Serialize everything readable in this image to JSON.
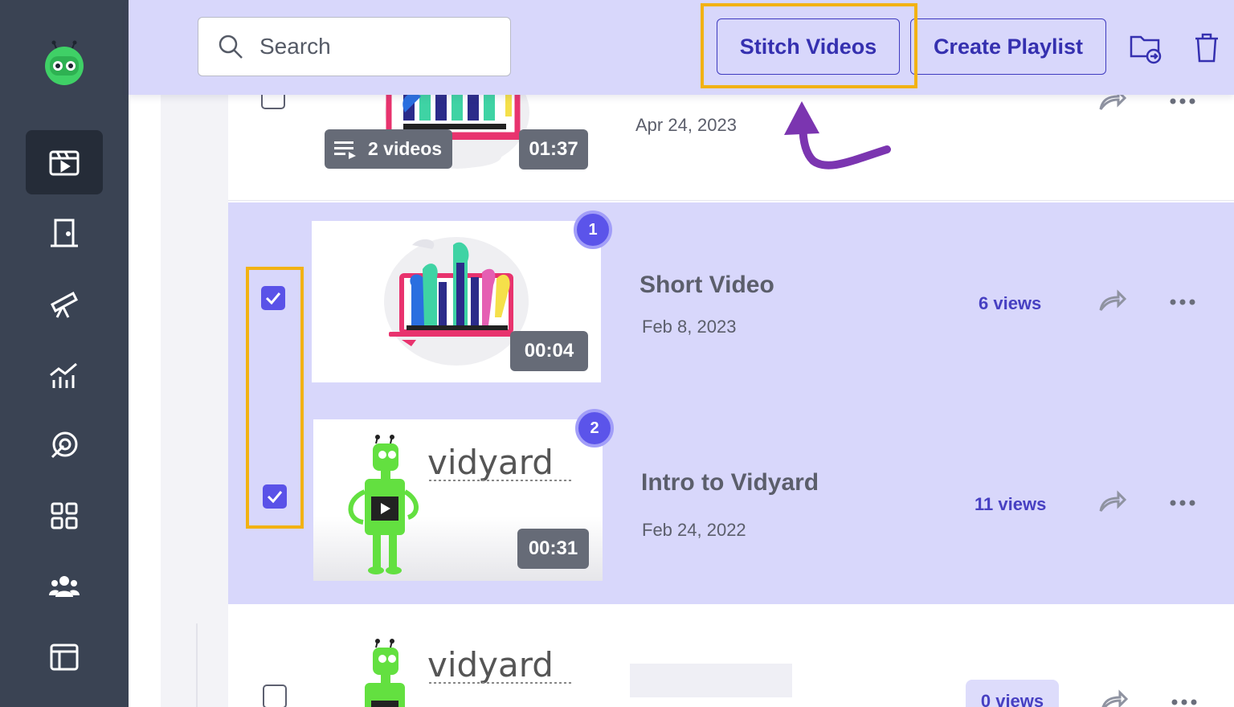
{
  "toolbar": {
    "search_placeholder": "Search",
    "stitch_label": "Stitch Videos",
    "playlist_label": "Create Playlist",
    "icons": [
      "move-to-folder-icon",
      "trash-icon"
    ]
  },
  "sidebar": {
    "items": [
      {
        "name": "videos",
        "icon": "video-library-icon",
        "active": true
      },
      {
        "name": "rooms",
        "icon": "door-icon",
        "active": false
      },
      {
        "name": "prospecting",
        "icon": "telescope-icon",
        "active": false
      },
      {
        "name": "analytics",
        "icon": "chart-icon",
        "active": false
      },
      {
        "name": "engagement",
        "icon": "target-icon",
        "active": false
      },
      {
        "name": "integrations",
        "icon": "apps-grid-icon",
        "active": false
      },
      {
        "name": "team",
        "icon": "team-icon",
        "active": false
      },
      {
        "name": "layouts",
        "icon": "layout-icon",
        "active": false
      }
    ]
  },
  "videos": [
    {
      "title": "",
      "date": "Apr 24, 2023",
      "duration": "01:37",
      "playlist_count": "2 videos",
      "views": "",
      "checked": false,
      "order": ""
    },
    {
      "title": "Short Video",
      "date": "Feb 8, 2023",
      "duration": "00:04",
      "views": "6 views",
      "checked": true,
      "order": "1"
    },
    {
      "title": "Intro to Vidyard",
      "date": "Feb 24, 2022",
      "duration": "00:31",
      "views": "11 views",
      "checked": true,
      "order": "2"
    },
    {
      "title": "",
      "date": "",
      "duration": "",
      "views": "0 views",
      "checked": false,
      "order": ""
    }
  ],
  "thumb_text": {
    "brand": "vidyard"
  },
  "colors": {
    "sidebar_bg": "#3a4353",
    "toolbar_bg": "#d8d7fb",
    "accent": "#5a52e8",
    "highlight": "#f2b213",
    "annotation_arrow": "#7b35b0"
  }
}
